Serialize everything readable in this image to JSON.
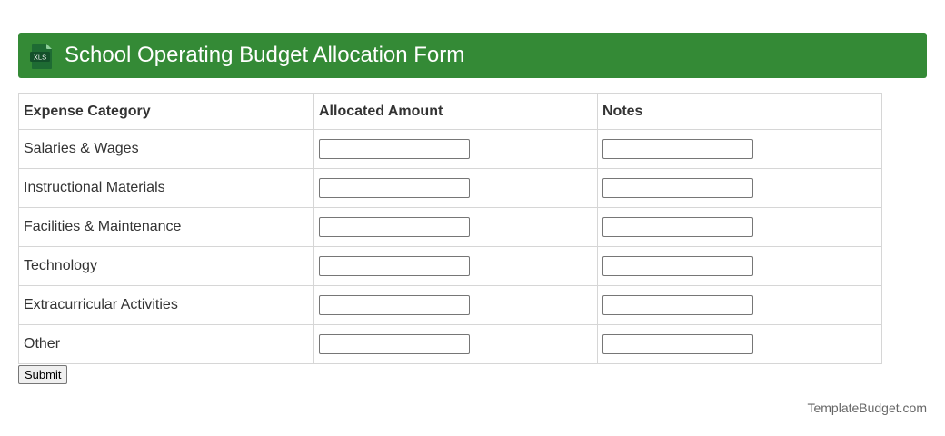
{
  "header": {
    "title": "School Operating Budget Allocation Form",
    "icon_label": "XLS",
    "background_color": "#348a36",
    "icon": "excel-file-icon"
  },
  "table": {
    "headers": [
      "Expense Category",
      "Allocated Amount",
      "Notes"
    ],
    "rows": [
      {
        "category": "Salaries & Wages",
        "amount": "",
        "notes": ""
      },
      {
        "category": "Instructional Materials",
        "amount": "",
        "notes": ""
      },
      {
        "category": "Facilities & Maintenance",
        "amount": "",
        "notes": ""
      },
      {
        "category": "Technology",
        "amount": "",
        "notes": ""
      },
      {
        "category": "Extracurricular Activities",
        "amount": "",
        "notes": ""
      },
      {
        "category": "Other",
        "amount": "",
        "notes": ""
      }
    ]
  },
  "form": {
    "submit_label": "Submit"
  },
  "footer": {
    "credit": "TemplateBudget.com"
  }
}
